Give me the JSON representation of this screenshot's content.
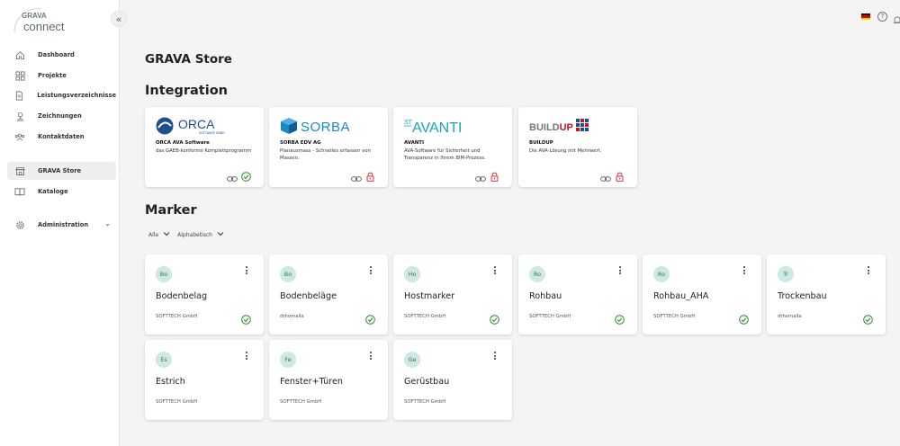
{
  "sidebar": {
    "logo_top": "GRAVA",
    "logo_bottom": "connect",
    "collapse": "«",
    "items": [
      {
        "label": "Dashboard",
        "icon": "home-icon"
      },
      {
        "label": "Projekte",
        "icon": "grid-icon"
      },
      {
        "label": "Leistungsverzeichnisse",
        "icon": "document-icon"
      },
      {
        "label": "Zeichnungen",
        "icon": "drawing-icon"
      },
      {
        "label": "Kontaktdaten",
        "icon": "contacts-icon"
      },
      {
        "label": "GRAVA Store",
        "icon": "store-icon",
        "active": true
      },
      {
        "label": "Kataloge",
        "icon": "book-icon"
      },
      {
        "label": "Administration",
        "icon": "gear-icon",
        "chevron": "⌄"
      }
    ]
  },
  "header": {
    "help": "?"
  },
  "page_title": "GRAVA Store",
  "integration": {
    "title": "Integration",
    "cards": [
      {
        "brand": "ORCA",
        "brand_sub": "SOFTWARE GMBH",
        "name": "ORCA AVA Software",
        "desc": "das GAEB-konforme Komplettprogramm",
        "state": "installed"
      },
      {
        "brand": "SORBA",
        "name": "SORBA EDV AG",
        "desc": "Planausmass - Schnelles erfassen von Massen.",
        "state": "locked"
      },
      {
        "brand": "AVANTI",
        "brand_prefix": "ST",
        "name": "AVANTI",
        "desc": "AVA-Software für Sicherheit und Transparenz in Ihrem BIM-Prozess.",
        "state": "locked"
      },
      {
        "brand": "BUILD",
        "brand_accent": "UP",
        "name": "BUILDUP",
        "desc": "Die AVA-Lösung mit Mehrwert.",
        "state": "locked"
      }
    ]
  },
  "marker": {
    "title": "Marker",
    "filter_all": "Alle",
    "filter_sort": "Alphabetisch",
    "cards": [
      {
        "initials": "Bo",
        "name": "Bodenbelag",
        "owner": "SOFTTECH GmbH"
      },
      {
        "initials": "Bo",
        "name": "Bodenbeläge",
        "owner": "dthomalla"
      },
      {
        "initials": "Ho",
        "name": "Hostmarker",
        "owner": "SOFTTECH GmbH"
      },
      {
        "initials": "Ro",
        "name": "Rohbau",
        "owner": "SOFTTECH GmbH"
      },
      {
        "initials": "Ro",
        "name": "Rohbau_AHA",
        "owner": "SOFTTECH GmbH"
      },
      {
        "initials": "Tr",
        "name": "Trockenbau",
        "owner": "dthomalla"
      },
      {
        "initials": "Es",
        "name": "Estrich",
        "owner": "SOFTTECH GmbH"
      },
      {
        "initials": "Fe",
        "name": "Fenster+Türen",
        "owner": "SOFTTECH GmbH"
      },
      {
        "initials": "Ge",
        "name": "Gerüstbau",
        "owner": "SOFTTECH GmbH"
      }
    ]
  },
  "colors": {
    "check": "#2e8b2e",
    "lock": "#d8344a",
    "avatar_bg": "#cde9e4",
    "orca_blue": "#1e4e8c",
    "sorba_blue": "#1b86c8",
    "avanti_teal": "#1aa5b8",
    "buildup_red": "#c8102e"
  }
}
